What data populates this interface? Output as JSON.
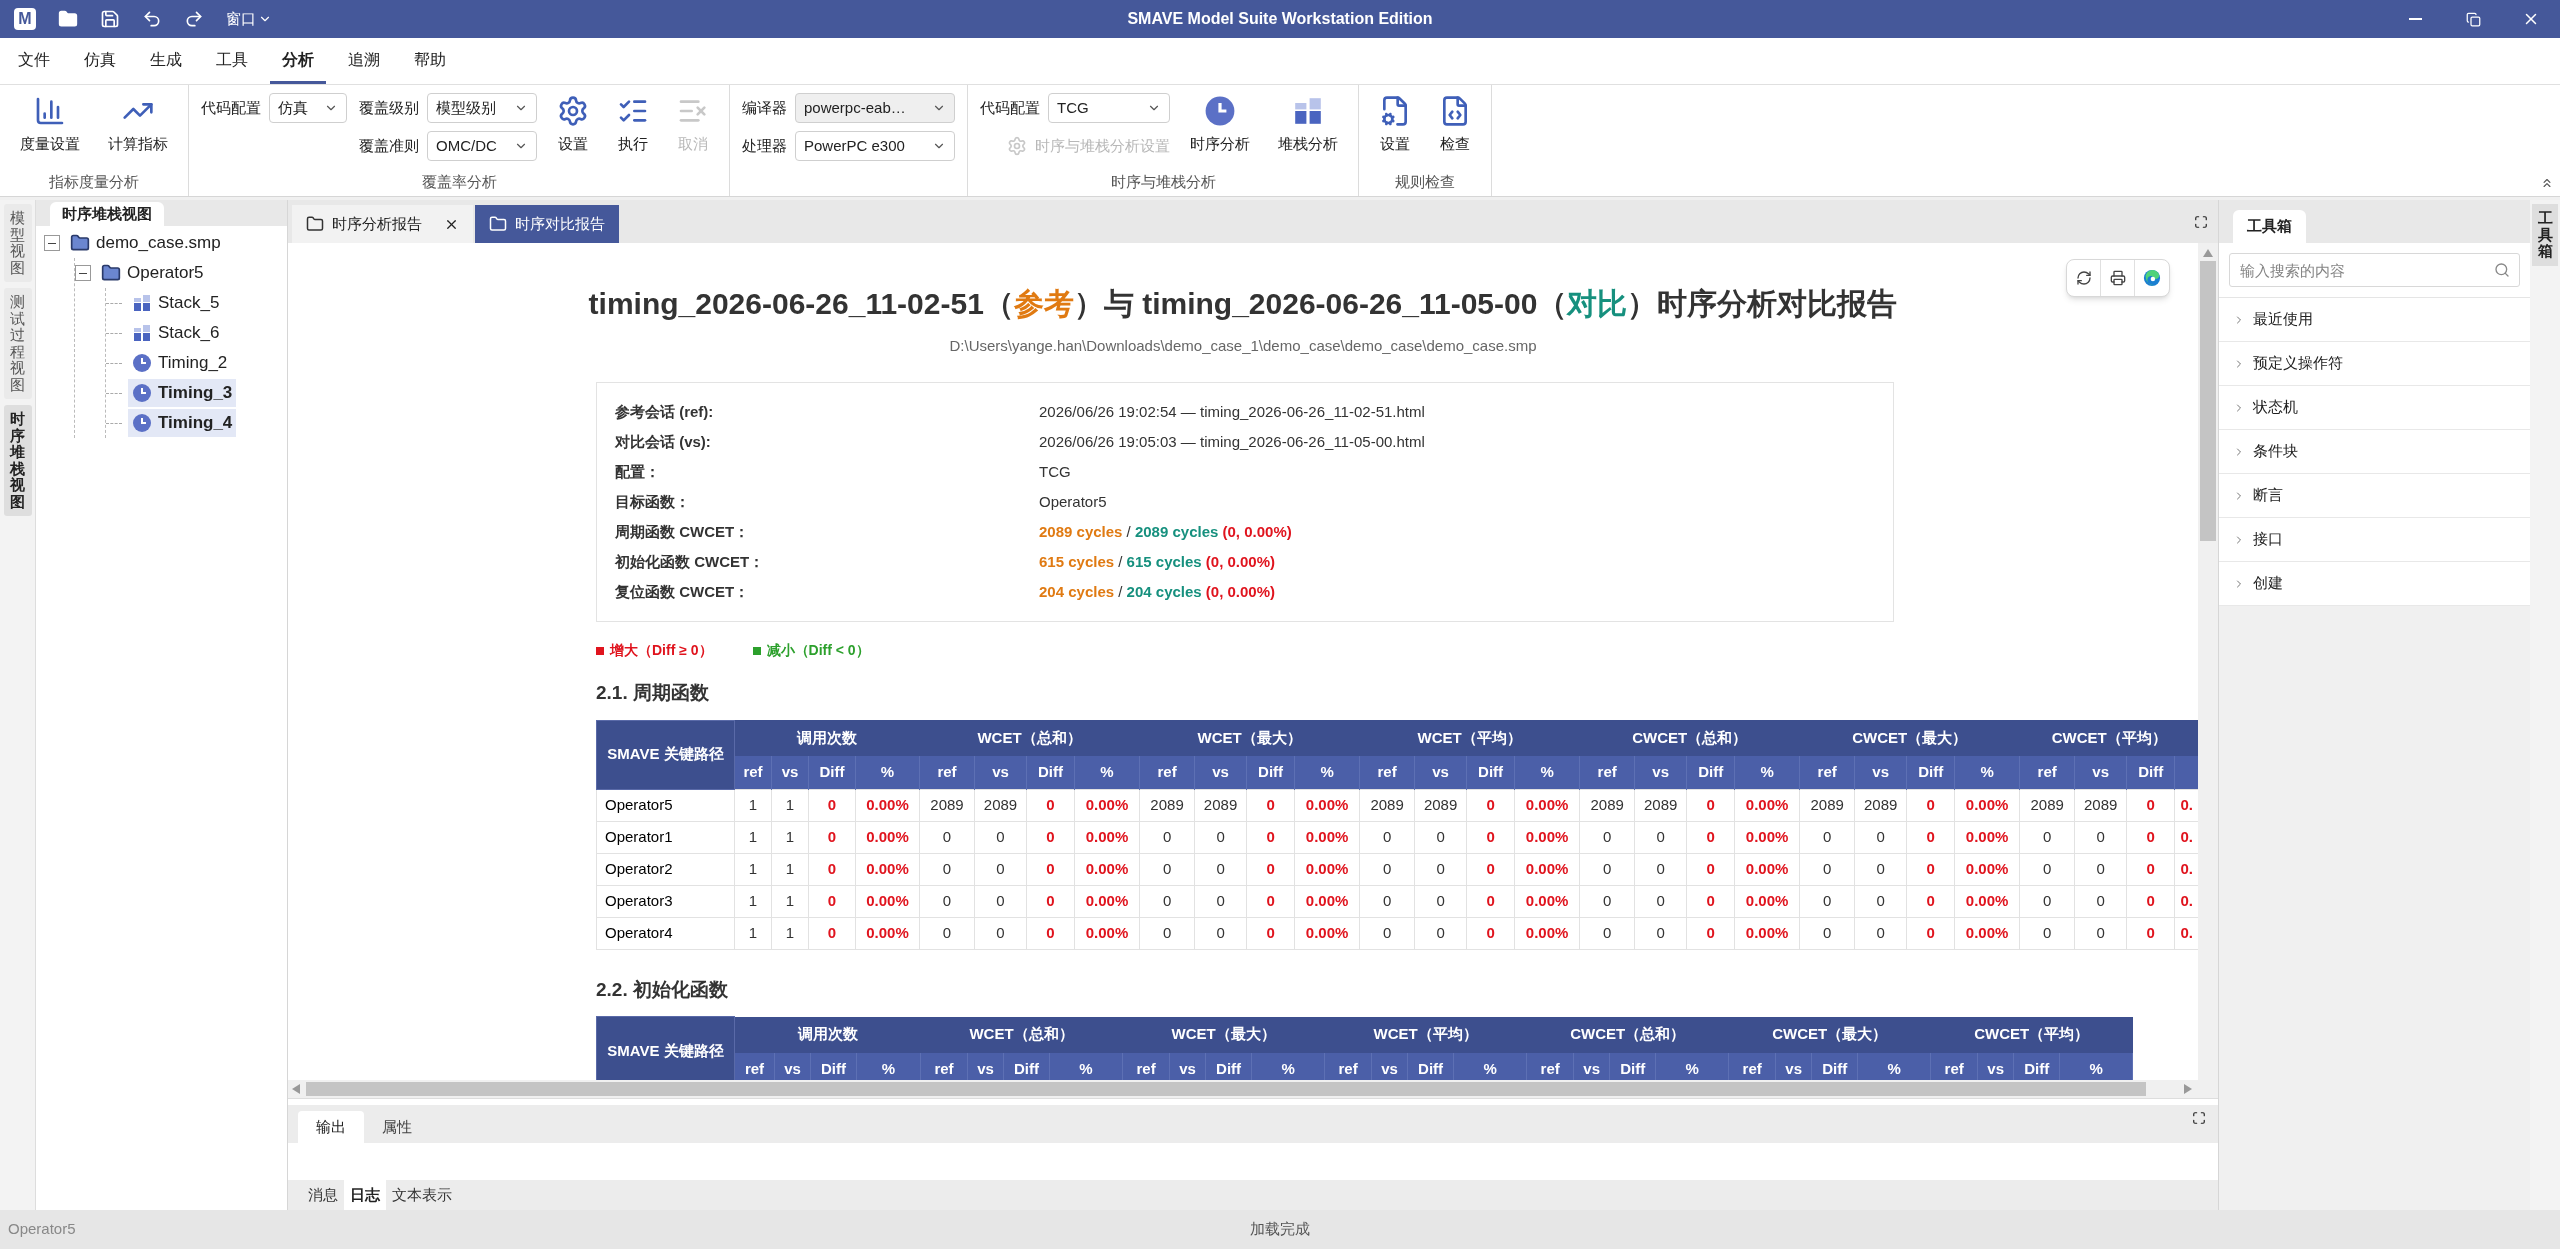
{
  "title_bar": {
    "logo": "M",
    "menu": "窗口",
    "title": "SMAVE Model Suite Workstation Edition"
  },
  "menu": [
    {
      "label": "文件",
      "selected": false
    },
    {
      "label": "仿真",
      "selected": false
    },
    {
      "label": "生成",
      "selected": false
    },
    {
      "label": "工具",
      "selected": false
    },
    {
      "label": "分析",
      "selected": true
    },
    {
      "label": "追溯",
      "selected": false
    },
    {
      "label": "帮助",
      "selected": false
    }
  ],
  "ribbon": [
    {
      "label": "指标度量分析",
      "items": [
        {
          "kind": "button",
          "label": "度量设置",
          "disabled": false
        },
        {
          "kind": "button",
          "label": "计算指标",
          "disabled": false
        }
      ]
    },
    {
      "label": "覆盖率分析",
      "items": [
        {
          "kind": "fields",
          "entries": [
            {
              "kind": "field",
              "label": "代码配置",
              "value": "仿真",
              "disabled": false
            }
          ]
        },
        {
          "kind": "fields",
          "entries": [
            {
              "kind": "field",
              "label": "覆盖级别",
              "value": "模型级别",
              "disabled": false
            },
            {
              "kind": "field",
              "label": "覆盖准则",
              "value": "OMC/DC",
              "disabled": false
            }
          ]
        },
        {
          "kind": "button",
          "label": "设置",
          "disabled": false
        },
        {
          "kind": "button",
          "label": "执行",
          "disabled": false
        },
        {
          "kind": "button",
          "label": "取消",
          "disabled": true
        }
      ]
    },
    {
      "items": [
        {
          "kind": "fields",
          "entries": [
            {
              "kind": "field",
              "label": "编译器",
              "value": "powerpc-eab…",
              "disabled": true
            },
            {
              "kind": "field",
              "label": "处理器",
              "value": "PowerPC e300",
              "disabled": false
            }
          ]
        }
      ]
    },
    {
      "label": "时序与堆栈分析",
      "items": [
        {
          "kind": "fields",
          "entries": [
            {
              "kind": "field",
              "label": "代码配置",
              "value": "TCG",
              "disabled": false
            },
            {
              "kind": "small_button",
              "label": "时序与堆栈分析设置",
              "disabled": true
            }
          ]
        },
        {
          "kind": "button",
          "label": "时序分析",
          "disabled": false
        },
        {
          "kind": "button",
          "label": "堆栈分析",
          "disabled": false
        }
      ]
    },
    {
      "label": "规则检查",
      "items": [
        {
          "kind": "button",
          "label": "设置",
          "disabled": false
        },
        {
          "kind": "button",
          "label": "检查",
          "disabled": false
        }
      ]
    }
  ],
  "left_tabs": [
    {
      "label": "模型视图",
      "selected": false
    },
    {
      "label": "测试过程视图",
      "selected": false
    },
    {
      "label": "时序堆栈视图",
      "selected": true
    }
  ],
  "tree_panel": {
    "tab": "时序堆栈视图",
    "tree": [
      {
        "kind": "file",
        "label": "demo_case.smp",
        "expanded": true,
        "selected": false,
        "children": [
          {
            "kind": "folder",
            "label": "Operator5",
            "expanded": true,
            "selected": false,
            "children": [
              {
                "kind": "stack",
                "label": "Stack_5",
                "selected": false
              },
              {
                "kind": "stack",
                "label": "Stack_6",
                "selected": false
              },
              {
                "kind": "timing",
                "label": "Timing_2",
                "selected": false
              },
              {
                "kind": "timing",
                "label": "Timing_3",
                "selected": true
              },
              {
                "kind": "timing",
                "label": "Timing_4",
                "selected": true
              }
            ]
          }
        ]
      }
    ]
  },
  "doc_tabs": [
    {
      "label": "时序分析报告",
      "selected": false,
      "closable": true
    },
    {
      "label": "时序对比报告",
      "selected": true,
      "closable": false
    }
  ],
  "report": {
    "title": [
      {
        "kind": "plain",
        "text": "timing_2026-06-26_11-02-51（"
      },
      {
        "kind": "ref",
        "text": "参考"
      },
      {
        "kind": "plain",
        "text": "）与 timing_2026-06-26_11-05-00（"
      },
      {
        "kind": "vs",
        "text": "对比"
      },
      {
        "kind": "plain",
        "text": "）时序分析对比报告"
      }
    ],
    "path": "D:\\Users\\yange.han\\Downloads\\demo_case_1\\demo_case\\demo_case\\demo_case.smp",
    "info": [
      {
        "kind": "text",
        "label": "参考会话 (ref):",
        "value": "2026/06/26 19:02:54 — timing_2026-06-26_11-02-51.html"
      },
      {
        "kind": "text",
        "label": "对比会话 (vs):",
        "value": "2026/06/26 19:05:03 — timing_2026-06-26_11-05-00.html"
      },
      {
        "kind": "text",
        "label": "配置：",
        "value": "TCG"
      },
      {
        "kind": "text",
        "label": "目标函数：",
        "value": "Operator5"
      },
      {
        "kind": "cycles",
        "label": "周期函数 CWCET：",
        "ref": "2089 cycles",
        "sep": "/",
        "vs": "2089 cycles",
        "diff": "(0, 0.00%)"
      },
      {
        "kind": "cycles",
        "label": "初始化函数 CWCET：",
        "ref": "615 cycles",
        "sep": "/",
        "vs": "615 cycles",
        "diff": "(0, 0.00%)"
      },
      {
        "kind": "cycles",
        "label": "复位函数 CWCET：",
        "ref": "204 cycles",
        "sep": "/",
        "vs": "204 cycles",
        "diff": "(0, 0.00%)"
      }
    ],
    "legend": [
      {
        "label": "增大（Diff ≥ 0）",
        "color": "#e0141e"
      },
      {
        "label": "减小（Diff < 0）",
        "color": "#2ca02c"
      }
    ],
    "sections": [
      {
        "heading": "2.1. 周期函数",
        "table": {
          "name_header": "SMAVE 关键路径",
          "groups": [
            {
              "label": "调用次数",
              "columns": [
                "ref",
                "vs",
                "Diff",
                "%"
              ]
            },
            {
              "label": "WCET（总和）",
              "columns": [
                "ref",
                "vs",
                "Diff",
                "%"
              ]
            },
            {
              "label": "WCET（最大）",
              "columns": [
                "ref",
                "vs",
                "Diff",
                "%"
              ]
            },
            {
              "label": "WCET（平均）",
              "columns": [
                "ref",
                "vs",
                "Diff",
                "%"
              ]
            },
            {
              "label": "CWCET（总和）",
              "columns": [
                "ref",
                "vs",
                "Diff",
                "%"
              ]
            },
            {
              "label": "CWCET（最大）",
              "columns": [
                "ref",
                "vs",
                "Diff",
                "%"
              ]
            },
            {
              "label": "CWCET（平均）",
              "columns": [
                "ref",
                "vs",
                "Diff"
              ]
            }
          ],
          "rows": [
            [
              "Operator5",
              "1",
              "1",
              "0",
              "0.00%",
              "2089",
              "2089",
              "0",
              "0.00%",
              "2089",
              "2089",
              "0",
              "0.00%",
              "2089",
              "2089",
              "0",
              "0.00%",
              "2089",
              "2089",
              "0",
              "0.00%",
              "2089",
              "2089",
              "0",
              "0.00%",
              "2089",
              "2089",
              "0",
              "0."
            ],
            [
              "Operator1",
              "1",
              "1",
              "0",
              "0.00%",
              "0",
              "0",
              "0",
              "0.00%",
              "0",
              "0",
              "0",
              "0.00%",
              "0",
              "0",
              "0",
              "0.00%",
              "0",
              "0",
              "0",
              "0.00%",
              "0",
              "0",
              "0",
              "0.00%",
              "0",
              "0",
              "0",
              "0."
            ],
            [
              "Operator2",
              "1",
              "1",
              "0",
              "0.00%",
              "0",
              "0",
              "0",
              "0.00%",
              "0",
              "0",
              "0",
              "0.00%",
              "0",
              "0",
              "0",
              "0.00%",
              "0",
              "0",
              "0",
              "0.00%",
              "0",
              "0",
              "0",
              "0.00%",
              "0",
              "0",
              "0",
              "0."
            ],
            [
              "Operator3",
              "1",
              "1",
              "0",
              "0.00%",
              "0",
              "0",
              "0",
              "0.00%",
              "0",
              "0",
              "0",
              "0.00%",
              "0",
              "0",
              "0",
              "0.00%",
              "0",
              "0",
              "0",
              "0.00%",
              "0",
              "0",
              "0",
              "0.00%",
              "0",
              "0",
              "0",
              "0."
            ],
            [
              "Operator4",
              "1",
              "1",
              "0",
              "0.00%",
              "0",
              "0",
              "0",
              "0.00%",
              "0",
              "0",
              "0",
              "0.00%",
              "0",
              "0",
              "0",
              "0.00%",
              "0",
              "0",
              "0",
              "0.00%",
              "0",
              "0",
              "0",
              "0.00%",
              "0",
              "0",
              "0",
              "0."
            ]
          ]
        }
      },
      {
        "heading": "2.2. 初始化函数",
        "table": {
          "name_header": "SMAVE 关键路径",
          "groups": [
            {
              "label": "调用次数",
              "columns": [
                "ref",
                "vs",
                "Diff",
                "%"
              ]
            },
            {
              "label": "WCET（总和）",
              "columns": [
                "ref",
                "vs",
                "Diff",
                "%"
              ]
            },
            {
              "label": "WCET（最大）",
              "columns": [
                "ref",
                "vs",
                "Diff",
                "%"
              ]
            },
            {
              "label": "WCET（平均）",
              "columns": [
                "ref",
                "vs",
                "Diff",
                "%"
              ]
            },
            {
              "label": "CWCET（总和）",
              "columns": [
                "ref",
                "vs",
                "Diff",
                "%"
              ]
            },
            {
              "label": "CWCET（最大）",
              "columns": [
                "ref",
                "vs",
                "Diff",
                "%"
              ]
            },
            {
              "label": "CWCET（平均）",
              "columns": [
                "ref",
                "vs",
                "Diff",
                "%"
              ]
            }
          ]
        }
      }
    ]
  },
  "toolbox": {
    "tab": "工具箱",
    "search": {
      "placeholder": "输入搜索的内容"
    },
    "items": [
      "最近使用",
      "预定义操作符",
      "状态机",
      "条件块",
      "断言",
      "接口",
      "创建"
    ]
  },
  "right_tabs": [
    {
      "label": "工具箱",
      "selected": true
    }
  ],
  "bottom_panel": {
    "tabs": [
      {
        "label": "输出",
        "selected": true
      },
      {
        "label": "属性",
        "selected": false
      }
    ],
    "subtabs": [
      {
        "label": "消息",
        "selected": false
      },
      {
        "label": "日志",
        "selected": true
      },
      {
        "label": "文本表示",
        "selected": false
      }
    ]
  },
  "status_bar": {
    "left": "Operator5",
    "center": "加载完成"
  }
}
